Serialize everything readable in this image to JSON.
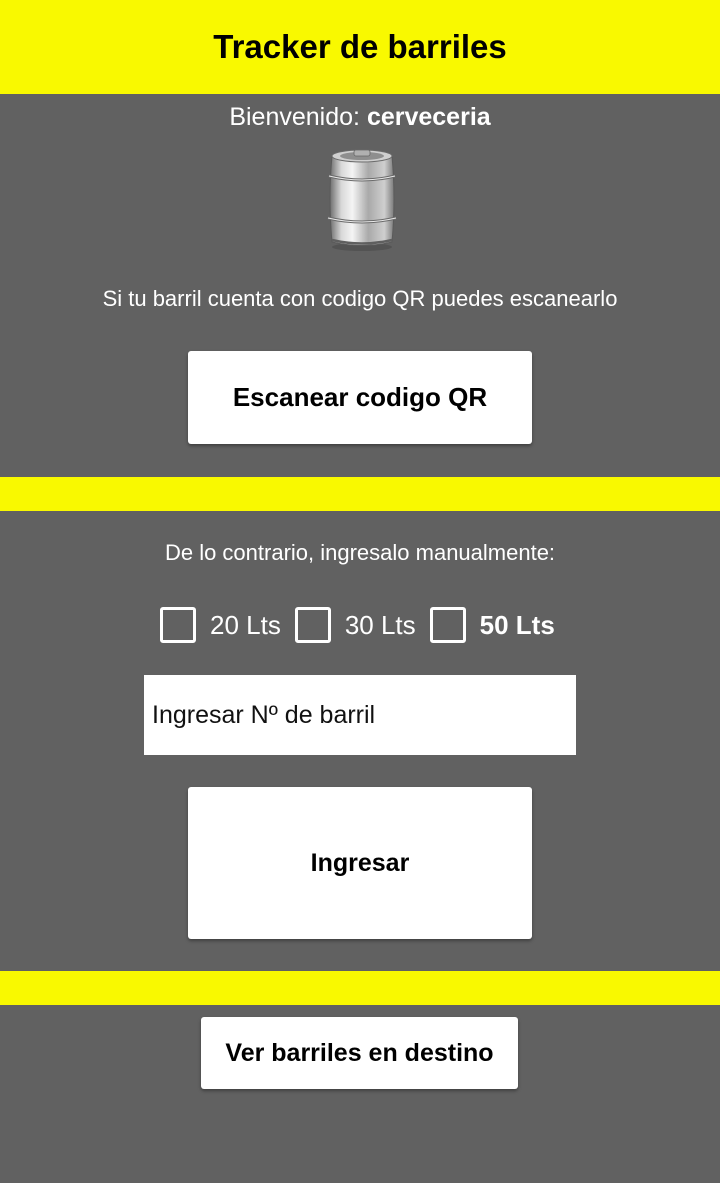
{
  "header": {
    "title": "Tracker de barriles"
  },
  "welcome": {
    "prefix": "Bienvenido: ",
    "username": "cerveceria"
  },
  "keg_image": {
    "icon": "beer-keg-icon"
  },
  "qr": {
    "hint": "Si tu barril cuenta con codigo QR puedes escanearlo",
    "button_label": "Escanear codigo QR"
  },
  "manual": {
    "hint": "De lo contrario, ingresalo manualmente:",
    "options": [
      {
        "label": "20 Lts",
        "checked": false
      },
      {
        "label": "30 Lts",
        "checked": false
      },
      {
        "label": "50 Lts",
        "checked": false
      }
    ],
    "input": {
      "placeholder": "Ingresar Nº de barril",
      "value": ""
    },
    "submit_label": "Ingresar"
  },
  "footer": {
    "view_button_label": "Ver barriles en destino"
  },
  "colors": {
    "accent": "#f9f900",
    "background": "#616161",
    "button": "#ffffff"
  }
}
